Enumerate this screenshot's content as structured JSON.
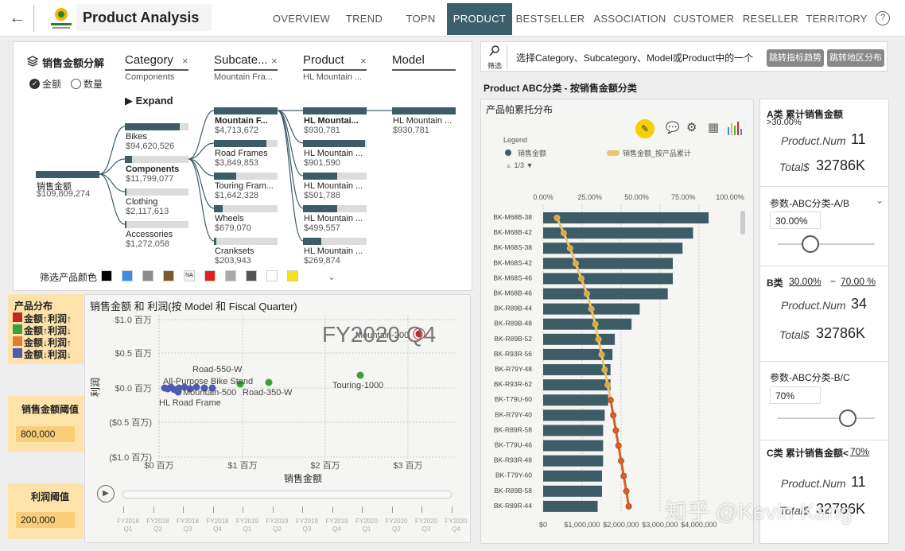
{
  "header": {
    "title": "Product Analysis",
    "tabs": [
      "OVERVIEW",
      "TREND",
      "TOPN",
      "PRODUCT",
      "BESTSELLER",
      "ASSOCIATION",
      "CUSTOMER",
      "RESELLER",
      "TERRITORY"
    ],
    "active_tab": "PRODUCT",
    "help": "?",
    "back": "←"
  },
  "decomp": {
    "title": "销售金额分解",
    "measure_amount": "金额",
    "measure_qty": "数量",
    "expand": "Expand",
    "levels": [
      {
        "name": "Category",
        "value": "Components"
      },
      {
        "name": "Subcate...",
        "value": "Mountain Fra..."
      },
      {
        "name": "Product",
        "value": "HL Mountain ..."
      },
      {
        "name": "Model",
        "value": ""
      }
    ],
    "root": {
      "label": "销售金额",
      "value": "$109,809,274"
    },
    "categories": [
      {
        "label": "Bikes",
        "value": "$94,620,526",
        "pct": 0.86
      },
      {
        "label": "Components",
        "value": "$11,799,077",
        "pct": 0.11
      },
      {
        "label": "Clothing",
        "value": "$2,117,613",
        "pct": 0.02
      },
      {
        "label": "Accessories",
        "value": "$1,272,058",
        "pct": 0.012
      }
    ],
    "subcategories": [
      {
        "label": "Mountain F...",
        "value": "$4,713,672",
        "pct": 1.0
      },
      {
        "label": "Road Frames",
        "value": "$3,849,853",
        "pct": 0.82
      },
      {
        "label": "Touring Fram...",
        "value": "$1,642,328",
        "pct": 0.35
      },
      {
        "label": "Wheels",
        "value": "$679,070",
        "pct": 0.14
      },
      {
        "label": "Cranksets",
        "value": "$203,943",
        "pct": 0.04
      }
    ],
    "products": [
      {
        "label": "HL Mountai...",
        "value": "$930,781",
        "pct": 1.0
      },
      {
        "label": "HL Mountain ...",
        "value": "$901,590",
        "pct": 0.97
      },
      {
        "label": "HL Mountain ...",
        "value": "$501,788",
        "pct": 0.54
      },
      {
        "label": "HL Mountain ...",
        "value": "$499,557",
        "pct": 0.54
      },
      {
        "label": "HL Mountain ...",
        "value": "$269,874",
        "pct": 0.29
      }
    ],
    "models": [
      {
        "label": "HL Mountain ...",
        "value": "$930,781",
        "pct": 1.0
      }
    ],
    "color_filter_label": "筛选产品颜色",
    "colors": [
      "#000000",
      "#3a8ee6",
      "#8c8c8c",
      "#7a5a2a",
      "NA",
      "#e0201b",
      "#a8a8a8",
      "#555555",
      "#ffffff",
      "#f7e018"
    ]
  },
  "filter_bar": {
    "icon_label": "筛选",
    "text": "选择Category、Subcategory、Model或Product中的一个",
    "btn1": "跳转指标趋势",
    "btn2": "跳转地区分布"
  },
  "legend_left": {
    "title": "产品分布",
    "items": [
      {
        "label": "金额↑利润↑",
        "color": "#c0282d"
      },
      {
        "label": "金额↑利润↓",
        "color": "#3aa13a"
      },
      {
        "label": "金额↓利润↑",
        "color": "#e07b39"
      },
      {
        "label": "金额↓利润↓",
        "color": "#4d5bb0"
      }
    ]
  },
  "thresholds": {
    "amount_label": "销售金额阈值",
    "amount_value": "800,000",
    "profit_label": "利润阈值",
    "profit_value": "200,000"
  },
  "scatter": {
    "title": "销售金额 和 利润(按 Model 和 Fiscal Quarter)",
    "big_label": "FY2020 Q4",
    "xlabel": "销售金额",
    "ylabel": "利润",
    "yticks": [
      "$1.0 百万",
      "$0.5 百万",
      "$0.0 百万",
      "($0.5 百万)",
      "($1.0 百万)"
    ],
    "xticks": [
      "$0 百万",
      "$1 百万",
      "$2 百万",
      "$3 百万"
    ],
    "points_labels": [
      "Mountain-200",
      "Touring-1000",
      "Road-550-W",
      "All-Purpose Bike Stand",
      "Mountain-500",
      "Road-350-W",
      "HL Road Frame"
    ],
    "timeline": [
      "FY2018 Q1",
      "FY2018 Q2",
      "FY2018 Q3",
      "FY2018 Q4",
      "FY2019 Q1",
      "FY2019 Q2",
      "FY2019 Q3",
      "FY2019 Q4",
      "FY2020 Q1",
      "FY2020 Q2",
      "FY2020 Q3",
      "FY2020 Q4"
    ],
    "play": "▶"
  },
  "chart_data": {
    "type": "bar",
    "title": "Product ABC分类 - 按销售金额分类",
    "subtitle": "产品帕累托分布",
    "legend": {
      "title": "Legend",
      "items": [
        "销售金额",
        "销售金额_按产品累计"
      ],
      "page": "1/3"
    },
    "categories": [
      "BK-M68B-38",
      "BK-M68B-42",
      "BK-M68S-38",
      "BK-M68S-42",
      "BK-M68S-46",
      "BK-M68B-46",
      "BK-R89B-44",
      "BK-R89B-48",
      "BK-R89B-52",
      "BK-R93R-56",
      "BK-R79Y-48",
      "BK-R93R-62",
      "BK-T79U-60",
      "BK-R79Y-40",
      "BK-R89R-58",
      "BK-T79U-46",
      "BK-R93R-48",
      "BK-T79Y-60",
      "BK-R89B-58",
      "BK-R89R-44"
    ],
    "series": [
      {
        "name": "销售金额",
        "values": [
          4250000,
          3850000,
          3580000,
          3330000,
          3330000,
          3200000,
          2480000,
          2270000,
          1840000,
          1780000,
          1730000,
          1730000,
          1670000,
          1580000,
          1540000,
          1540000,
          1540000,
          1510000,
          1510000,
          1400000
        ]
      },
      {
        "name": "销售金额_按产品累计",
        "values": [
          0.04,
          0.076,
          0.11,
          0.14,
          0.17,
          0.2,
          0.224,
          0.245,
          0.262,
          0.279,
          0.295,
          0.311,
          0.327,
          0.341,
          0.355,
          0.369,
          0.383,
          0.397,
          0.411,
          0.424
        ]
      }
    ],
    "xticks": [
      "$0",
      "$1,000,000",
      "$2,000,000",
      "$3,000,000",
      "$4,000,000"
    ],
    "xticks_top": [
      "0.00%",
      "25.00%",
      "50.00%",
      "75.00%",
      "100.00%"
    ],
    "xlim": [
      0,
      4800000
    ]
  },
  "abc": {
    "a_title": "A类 累计销售金额",
    "a_cond": ">30.00%",
    "a_num_label": "Product.Num",
    "a_num": "11",
    "a_total_label": "Total$",
    "a_total": "32786K",
    "param_a_label": "参数-ABC分类-A/B",
    "param_a_value": "30.00%",
    "b_title_prefix": "B类",
    "b_low": "30.00%",
    "b_sep": "~",
    "b_high": "70.00 %",
    "b_num_label": "Product.Num",
    "b_num": "34",
    "b_total_label": "Total$",
    "b_total": "32786K",
    "param_b_label": "参数-ABC分类-B/C",
    "param_b_value": "70%",
    "c_title": "C类 累计销售金额<",
    "c_cond": "70%",
    "c_num_label": "Product.Num",
    "c_num": "11",
    "c_total_label": "Total$",
    "c_total": "32786K"
  },
  "watermark": "知乎 @Kevin Kang"
}
